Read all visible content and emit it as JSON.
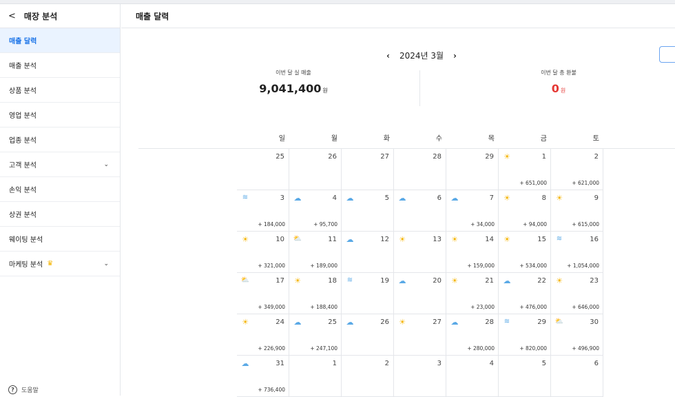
{
  "sidebar": {
    "back_glyph": "<",
    "title": "매장 분석",
    "items": [
      {
        "label": "매출 달력",
        "active": true,
        "chevron": false,
        "crown": false
      },
      {
        "label": "매출 분석",
        "active": false,
        "chevron": false,
        "crown": false
      },
      {
        "label": "상품 분석",
        "active": false,
        "chevron": false,
        "crown": false
      },
      {
        "label": "영업 분석",
        "active": false,
        "chevron": false,
        "crown": false
      },
      {
        "label": "업종 분석",
        "active": false,
        "chevron": false,
        "crown": false
      },
      {
        "label": "고객 분석",
        "active": false,
        "chevron": true,
        "crown": false
      },
      {
        "label": "손익 분석",
        "active": false,
        "chevron": false,
        "crown": false
      },
      {
        "label": "상권 분석",
        "active": false,
        "chevron": false,
        "crown": false
      },
      {
        "label": "웨이팅 분석",
        "active": false,
        "chevron": false,
        "crown": false
      },
      {
        "label": "마케팅 분석",
        "active": false,
        "chevron": true,
        "crown": true
      }
    ],
    "help_label": "도움말"
  },
  "main": {
    "title": "매출 달력",
    "month_label": "2024년 3월",
    "summary": {
      "sales_label": "이번 달 실 매출",
      "sales_value": "9,041,400",
      "sales_unit": "원",
      "refund_label": "이번 달 총 환불",
      "refund_value": "0",
      "refund_unit": "원"
    },
    "weekdays": [
      "일",
      "월",
      "화",
      "수",
      "목",
      "금",
      "토"
    ],
    "weeks": [
      [
        {
          "day": "25",
          "wx": "",
          "amt": ""
        },
        {
          "day": "26",
          "wx": "",
          "amt": ""
        },
        {
          "day": "27",
          "wx": "",
          "amt": ""
        },
        {
          "day": "28",
          "wx": "",
          "amt": ""
        },
        {
          "day": "29",
          "wx": "",
          "amt": ""
        },
        {
          "day": "1",
          "wx": "sunny",
          "amt": "+ 651,000"
        },
        {
          "day": "2",
          "wx": "",
          "amt": "+ 621,000"
        }
      ],
      [
        {
          "day": "3",
          "wx": "fog",
          "amt": "+ 184,000"
        },
        {
          "day": "4",
          "wx": "cloudy",
          "amt": "+ 95,700"
        },
        {
          "day": "5",
          "wx": "rain",
          "amt": ""
        },
        {
          "day": "6",
          "wx": "cloudy",
          "amt": ""
        },
        {
          "day": "7",
          "wx": "cloudy",
          "amt": "+ 34,000"
        },
        {
          "day": "8",
          "wx": "sunny",
          "amt": "+ 94,000"
        },
        {
          "day": "9",
          "wx": "sunny",
          "amt": "+ 615,000"
        }
      ],
      [
        {
          "day": "10",
          "wx": "sunny",
          "amt": "+ 321,000"
        },
        {
          "day": "11",
          "wx": "partly",
          "amt": "+ 189,000"
        },
        {
          "day": "12",
          "wx": "cloudy",
          "amt": ""
        },
        {
          "day": "13",
          "wx": "sunny",
          "amt": ""
        },
        {
          "day": "14",
          "wx": "sunny",
          "amt": "+ 159,000"
        },
        {
          "day": "15",
          "wx": "sunny",
          "amt": "+ 534,000"
        },
        {
          "day": "16",
          "wx": "fog",
          "amt": "+ 1,054,000"
        }
      ],
      [
        {
          "day": "17",
          "wx": "partly",
          "amt": "+ 349,000"
        },
        {
          "day": "18",
          "wx": "sunny",
          "amt": "+ 188,400"
        },
        {
          "day": "19",
          "wx": "fog",
          "amt": ""
        },
        {
          "day": "20",
          "wx": "cloudy",
          "amt": ""
        },
        {
          "day": "21",
          "wx": "sunny",
          "amt": "+ 23,000"
        },
        {
          "day": "22",
          "wx": "cloudy",
          "amt": "+ 476,000"
        },
        {
          "day": "23",
          "wx": "sunny",
          "amt": "+ 646,000"
        }
      ],
      [
        {
          "day": "24",
          "wx": "sunny",
          "amt": "+ 226,900"
        },
        {
          "day": "25",
          "wx": "rain",
          "amt": "+ 247,100"
        },
        {
          "day": "26",
          "wx": "cloudy",
          "amt": ""
        },
        {
          "day": "27",
          "wx": "sunny",
          "amt": ""
        },
        {
          "day": "28",
          "wx": "rain",
          "amt": "+ 280,000"
        },
        {
          "day": "29",
          "wx": "fog",
          "amt": "+ 820,000"
        },
        {
          "day": "30",
          "wx": "partly",
          "amt": "+ 496,900"
        }
      ],
      [
        {
          "day": "31",
          "wx": "cloudy",
          "amt": "+ 736,400"
        },
        {
          "day": "1",
          "wx": "",
          "amt": ""
        },
        {
          "day": "2",
          "wx": "",
          "amt": ""
        },
        {
          "day": "3",
          "wx": "",
          "amt": ""
        },
        {
          "day": "4",
          "wx": "",
          "amt": ""
        },
        {
          "day": "5",
          "wx": "",
          "amt": ""
        },
        {
          "day": "6",
          "wx": "",
          "amt": ""
        }
      ]
    ]
  },
  "icons": {
    "sunny": "sun-icon",
    "partly": "partly-cloudy-icon",
    "cloudy": "cloud-icon",
    "rain": "rain-cloud-icon",
    "fog": "fog-icon"
  },
  "colors": {
    "accent": "#1a73e8",
    "active_bg": "#eaf3ff",
    "refund_red": "#e53935",
    "sun": "#f5b400",
    "cloud": "#5aa9e6"
  }
}
